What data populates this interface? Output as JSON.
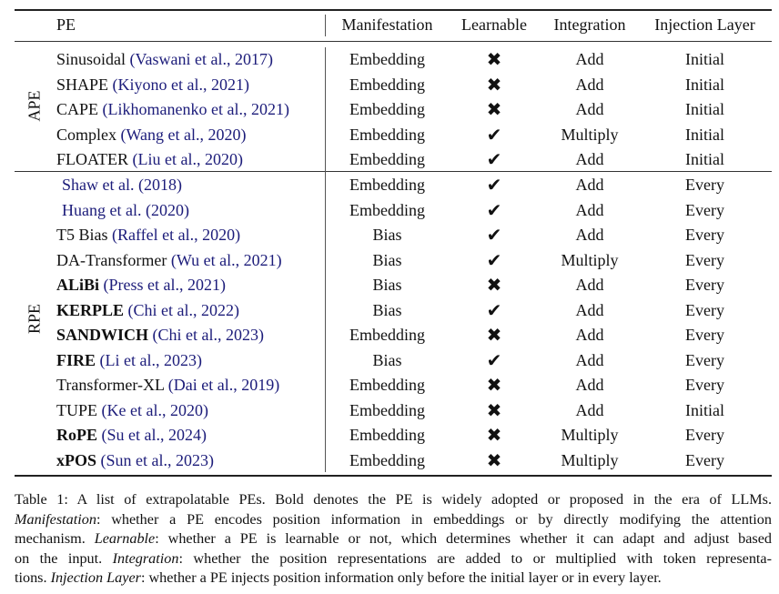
{
  "table": {
    "headers": {
      "pe": "PE",
      "manifestation": "Manifestation",
      "learnable": "Learnable",
      "integration": "Integration",
      "injection_layer": "Injection Layer"
    },
    "groups": [
      {
        "label": "APE",
        "rows": [
          {
            "name": "Sinusoidal",
            "bold": false,
            "cite": "(Vaswani et al., 2017)",
            "manifestation": "Embedding",
            "learnable": false,
            "integration": "Add",
            "injection": "Initial"
          },
          {
            "name": "SHAPE",
            "bold": false,
            "cite": "(Kiyono et al., 2021)",
            "manifestation": "Embedding",
            "learnable": false,
            "integration": "Add",
            "injection": "Initial"
          },
          {
            "name": "CAPE",
            "bold": false,
            "cite": "(Likhomanenko et al., 2021)",
            "manifestation": "Embedding",
            "learnable": false,
            "integration": "Add",
            "injection": "Initial"
          },
          {
            "name": "Complex",
            "bold": false,
            "cite": "(Wang et al., 2020)",
            "manifestation": "Embedding",
            "learnable": true,
            "integration": "Multiply",
            "injection": "Initial"
          },
          {
            "name": "FLOATER",
            "bold": false,
            "cite": "(Liu et al., 2020)",
            "manifestation": "Embedding",
            "learnable": true,
            "integration": "Add",
            "injection": "Initial"
          }
        ]
      },
      {
        "label": "RPE",
        "rows": [
          {
            "name": "",
            "bold": false,
            "cite": "Shaw et al. (2018)",
            "manifestation": "Embedding",
            "learnable": true,
            "integration": "Add",
            "injection": "Every"
          },
          {
            "name": "",
            "bold": false,
            "cite": "Huang et al. (2020)",
            "manifestation": "Embedding",
            "learnable": true,
            "integration": "Add",
            "injection": "Every"
          },
          {
            "name": "T5 Bias",
            "bold": false,
            "cite": "(Raffel et al., 2020)",
            "manifestation": "Bias",
            "learnable": true,
            "integration": "Add",
            "injection": "Every"
          },
          {
            "name": "DA-Transformer",
            "bold": false,
            "cite": "(Wu et al., 2021)",
            "manifestation": "Bias",
            "learnable": true,
            "integration": "Multiply",
            "injection": "Every"
          },
          {
            "name": "ALiBi",
            "bold": true,
            "cite": "(Press et al., 2021)",
            "manifestation": "Bias",
            "learnable": false,
            "integration": "Add",
            "injection": "Every"
          },
          {
            "name": "KERPLE",
            "bold": true,
            "cite": "(Chi et al., 2022)",
            "manifestation": "Bias",
            "learnable": true,
            "integration": "Add",
            "injection": "Every"
          },
          {
            "name": "SANDWICH",
            "bold": true,
            "cite": "(Chi et al., 2023)",
            "manifestation": "Embedding",
            "learnable": false,
            "integration": "Add",
            "injection": "Every"
          },
          {
            "name": "FIRE",
            "bold": true,
            "cite": "(Li et al., 2023)",
            "manifestation": "Bias",
            "learnable": true,
            "integration": "Add",
            "injection": "Every"
          },
          {
            "name": "Transformer-XL",
            "bold": false,
            "cite": "(Dai et al., 2019)",
            "manifestation": "Embedding",
            "learnable": false,
            "integration": "Add",
            "injection": "Every"
          },
          {
            "name": "TUPE",
            "bold": false,
            "cite": "(Ke et al., 2020)",
            "manifestation": "Embedding",
            "learnable": false,
            "integration": "Add",
            "injection": "Initial"
          },
          {
            "name": "RoPE",
            "bold": true,
            "cite": "(Su et al., 2024)",
            "manifestation": "Embedding",
            "learnable": false,
            "integration": "Multiply",
            "injection": "Every"
          },
          {
            "name": "xPOS",
            "bold": true,
            "cite": "(Sun et al., 2023)",
            "manifestation": "Embedding",
            "learnable": false,
            "integration": "Multiply",
            "injection": "Every"
          }
        ]
      }
    ],
    "marks": {
      "true": "✔",
      "false": "✖"
    }
  },
  "caption": {
    "lines": [
      [
        {
          "t": "Table 1: A list of extrapolatable PEs.  Bold denotes the PE is widely adopted or proposed in the era of LLMs.",
          "i": false
        }
      ],
      [
        {
          "t": "Manifestation",
          "i": true
        },
        {
          "t": ": whether a PE encodes position information in embeddings or by directly modifying the attention",
          "i": false
        }
      ],
      [
        {
          "t": "mechanism. ",
          "i": false
        },
        {
          "t": "Learnable",
          "i": true
        },
        {
          "t": ": whether a PE is learnable or not, which determines whether it can adapt and adjust based",
          "i": false
        }
      ],
      [
        {
          "t": "on the input. ",
          "i": false
        },
        {
          "t": "Integration",
          "i": true
        },
        {
          "t": ": whether the position representations are added to or multiplied with token representa-",
          "i": false
        }
      ],
      [
        {
          "t": "tions. ",
          "i": false
        },
        {
          "t": "Injection Layer",
          "i": true
        },
        {
          "t": ": whether a PE injects position information only before the initial layer or in every layer.",
          "i": false
        }
      ]
    ]
  }
}
